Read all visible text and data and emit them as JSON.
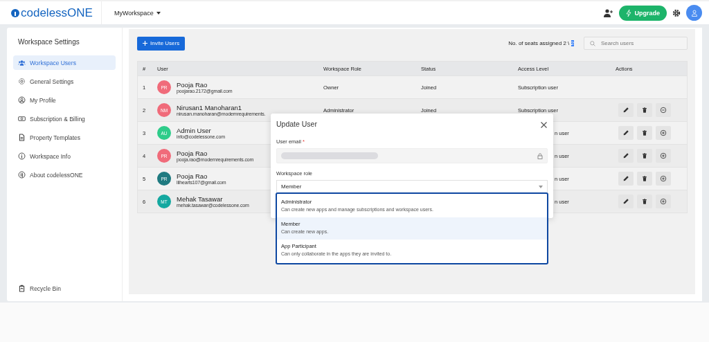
{
  "header": {
    "logo": "codelessONE",
    "workspace": "MyWorkspace",
    "upgrade": "Upgrade"
  },
  "sidebar": {
    "title": "Workspace Settings",
    "items": [
      {
        "label": "Workspace Users",
        "selected": true
      },
      {
        "label": "General Settings",
        "selected": false
      },
      {
        "label": "My Profile",
        "selected": false
      },
      {
        "label": "Subscription & Billing",
        "selected": false
      },
      {
        "label": "Property Templates",
        "selected": false
      },
      {
        "label": "Workspace Info",
        "selected": false
      },
      {
        "label": "About codelessONE",
        "selected": false
      }
    ],
    "footer_item": {
      "label": "Recycle Bin"
    }
  },
  "toolbar": {
    "invite_button": "Invite Users",
    "seats_label": "No. of seats assigned 2 \\",
    "seats_total": "2",
    "seats_total_selected": true,
    "search": {
      "placeholder": "Search users"
    }
  },
  "table": {
    "columns": [
      "#",
      "User",
      "Workspace Role",
      "Status",
      "Access Level",
      "Actions"
    ],
    "rows": [
      {
        "index": "1",
        "initials": "PR",
        "color": "#f06b7a",
        "name": "Pooja Rao",
        "email": "poojarao.2172@gmail.com",
        "role": "Owner",
        "status": "Joined",
        "access": "Subscription user",
        "covered": false
      },
      {
        "index": "2",
        "initials": "NM",
        "color": "#f06b7a",
        "name": "Nirusan1 Manoharan1",
        "email": "nirusan.manoharan@modernrequirements.",
        "role": "Administrator",
        "status": "Joined",
        "access": "Subscription user",
        "covered": false,
        "actions": [
          {
            "kind": "edit"
          },
          {
            "kind": "delete"
          },
          {
            "kind": "remove"
          }
        ]
      },
      {
        "index": "3",
        "initials": "AU",
        "color": "#2ecc8a",
        "name": "Admin User",
        "email": "info@codelessone.com",
        "access": "n user",
        "covered": true,
        "actions": [
          {
            "kind": "edit"
          },
          {
            "kind": "delete"
          },
          {
            "kind": "add"
          }
        ]
      },
      {
        "index": "4",
        "initials": "PR",
        "color": "#f06b7a",
        "name": "Pooja Rao",
        "email": "pooja.rao@modernrequirements.com",
        "access": "n user",
        "covered": true,
        "actions": [
          {
            "kind": "edit"
          },
          {
            "kind": "delete"
          },
          {
            "kind": "add"
          }
        ]
      },
      {
        "index": "5",
        "initials": "PR",
        "color": "#1f7a80",
        "name": "Pooja Rao",
        "email": "lilhearts107@gmail.com",
        "access": "n user",
        "covered": true,
        "actions": [
          {
            "kind": "edit"
          },
          {
            "kind": "delete"
          },
          {
            "kind": "add"
          }
        ]
      },
      {
        "index": "6",
        "initials": "MT",
        "color": "#14a8a0",
        "name": "Mehak Tasawar",
        "email": "mehak.tasawar@codelessone.com",
        "access": "n user",
        "covered": true,
        "actions": [
          {
            "kind": "edit"
          },
          {
            "kind": "delete"
          },
          {
            "kind": "add"
          }
        ]
      }
    ]
  },
  "dialog": {
    "title": "Update User",
    "email_label": "User email",
    "required_mark": "*",
    "role_label": "Workspace role",
    "role_value": "Member",
    "options": [
      {
        "title": "Administrator",
        "description": "Can create new apps and manage subscriptions and workspace users.",
        "selected": false
      },
      {
        "title": "Member",
        "description": "Can create new apps.",
        "selected": true
      },
      {
        "title": "App Participant",
        "description": "Can only collaborate in the apps they are invited to.",
        "selected": false
      }
    ]
  }
}
